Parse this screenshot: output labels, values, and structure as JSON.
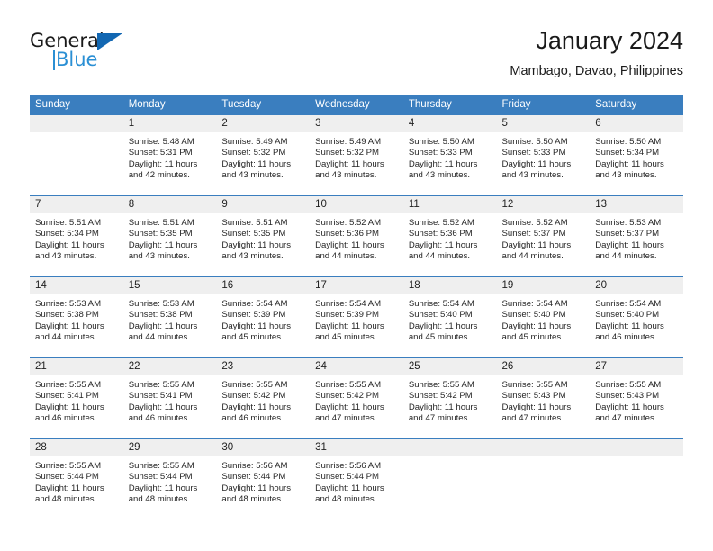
{
  "logo": {
    "text_top": "General",
    "text_bottom": "Blue",
    "accent_dark": "#1267b2",
    "accent_light": "#2a8fd4"
  },
  "header": {
    "title": "January 2024",
    "subtitle": "Mambago, Davao, Philippines"
  },
  "theme": {
    "header_blue": "#3a7ebf",
    "daynum_gray": "#efefef",
    "text": "#222222"
  },
  "weekdays": [
    "Sunday",
    "Monday",
    "Tuesday",
    "Wednesday",
    "Thursday",
    "Friday",
    "Saturday"
  ],
  "weeks": [
    [
      {
        "day": "",
        "sunrise": "",
        "sunset": "",
        "daylight1": "",
        "daylight2": ""
      },
      {
        "day": "1",
        "sunrise": "Sunrise: 5:48 AM",
        "sunset": "Sunset: 5:31 PM",
        "daylight1": "Daylight: 11 hours",
        "daylight2": "and 42 minutes."
      },
      {
        "day": "2",
        "sunrise": "Sunrise: 5:49 AM",
        "sunset": "Sunset: 5:32 PM",
        "daylight1": "Daylight: 11 hours",
        "daylight2": "and 43 minutes."
      },
      {
        "day": "3",
        "sunrise": "Sunrise: 5:49 AM",
        "sunset": "Sunset: 5:32 PM",
        "daylight1": "Daylight: 11 hours",
        "daylight2": "and 43 minutes."
      },
      {
        "day": "4",
        "sunrise": "Sunrise: 5:50 AM",
        "sunset": "Sunset: 5:33 PM",
        "daylight1": "Daylight: 11 hours",
        "daylight2": "and 43 minutes."
      },
      {
        "day": "5",
        "sunrise": "Sunrise: 5:50 AM",
        "sunset": "Sunset: 5:33 PM",
        "daylight1": "Daylight: 11 hours",
        "daylight2": "and 43 minutes."
      },
      {
        "day": "6",
        "sunrise": "Sunrise: 5:50 AM",
        "sunset": "Sunset: 5:34 PM",
        "daylight1": "Daylight: 11 hours",
        "daylight2": "and 43 minutes."
      }
    ],
    [
      {
        "day": "7",
        "sunrise": "Sunrise: 5:51 AM",
        "sunset": "Sunset: 5:34 PM",
        "daylight1": "Daylight: 11 hours",
        "daylight2": "and 43 minutes."
      },
      {
        "day": "8",
        "sunrise": "Sunrise: 5:51 AM",
        "sunset": "Sunset: 5:35 PM",
        "daylight1": "Daylight: 11 hours",
        "daylight2": "and 43 minutes."
      },
      {
        "day": "9",
        "sunrise": "Sunrise: 5:51 AM",
        "sunset": "Sunset: 5:35 PM",
        "daylight1": "Daylight: 11 hours",
        "daylight2": "and 43 minutes."
      },
      {
        "day": "10",
        "sunrise": "Sunrise: 5:52 AM",
        "sunset": "Sunset: 5:36 PM",
        "daylight1": "Daylight: 11 hours",
        "daylight2": "and 44 minutes."
      },
      {
        "day": "11",
        "sunrise": "Sunrise: 5:52 AM",
        "sunset": "Sunset: 5:36 PM",
        "daylight1": "Daylight: 11 hours",
        "daylight2": "and 44 minutes."
      },
      {
        "day": "12",
        "sunrise": "Sunrise: 5:52 AM",
        "sunset": "Sunset: 5:37 PM",
        "daylight1": "Daylight: 11 hours",
        "daylight2": "and 44 minutes."
      },
      {
        "day": "13",
        "sunrise": "Sunrise: 5:53 AM",
        "sunset": "Sunset: 5:37 PM",
        "daylight1": "Daylight: 11 hours",
        "daylight2": "and 44 minutes."
      }
    ],
    [
      {
        "day": "14",
        "sunrise": "Sunrise: 5:53 AM",
        "sunset": "Sunset: 5:38 PM",
        "daylight1": "Daylight: 11 hours",
        "daylight2": "and 44 minutes."
      },
      {
        "day": "15",
        "sunrise": "Sunrise: 5:53 AM",
        "sunset": "Sunset: 5:38 PM",
        "daylight1": "Daylight: 11 hours",
        "daylight2": "and 44 minutes."
      },
      {
        "day": "16",
        "sunrise": "Sunrise: 5:54 AM",
        "sunset": "Sunset: 5:39 PM",
        "daylight1": "Daylight: 11 hours",
        "daylight2": "and 45 minutes."
      },
      {
        "day": "17",
        "sunrise": "Sunrise: 5:54 AM",
        "sunset": "Sunset: 5:39 PM",
        "daylight1": "Daylight: 11 hours",
        "daylight2": "and 45 minutes."
      },
      {
        "day": "18",
        "sunrise": "Sunrise: 5:54 AM",
        "sunset": "Sunset: 5:40 PM",
        "daylight1": "Daylight: 11 hours",
        "daylight2": "and 45 minutes."
      },
      {
        "day": "19",
        "sunrise": "Sunrise: 5:54 AM",
        "sunset": "Sunset: 5:40 PM",
        "daylight1": "Daylight: 11 hours",
        "daylight2": "and 45 minutes."
      },
      {
        "day": "20",
        "sunrise": "Sunrise: 5:54 AM",
        "sunset": "Sunset: 5:40 PM",
        "daylight1": "Daylight: 11 hours",
        "daylight2": "and 46 minutes."
      }
    ],
    [
      {
        "day": "21",
        "sunrise": "Sunrise: 5:55 AM",
        "sunset": "Sunset: 5:41 PM",
        "daylight1": "Daylight: 11 hours",
        "daylight2": "and 46 minutes."
      },
      {
        "day": "22",
        "sunrise": "Sunrise: 5:55 AM",
        "sunset": "Sunset: 5:41 PM",
        "daylight1": "Daylight: 11 hours",
        "daylight2": "and 46 minutes."
      },
      {
        "day": "23",
        "sunrise": "Sunrise: 5:55 AM",
        "sunset": "Sunset: 5:42 PM",
        "daylight1": "Daylight: 11 hours",
        "daylight2": "and 46 minutes."
      },
      {
        "day": "24",
        "sunrise": "Sunrise: 5:55 AM",
        "sunset": "Sunset: 5:42 PM",
        "daylight1": "Daylight: 11 hours",
        "daylight2": "and 47 minutes."
      },
      {
        "day": "25",
        "sunrise": "Sunrise: 5:55 AM",
        "sunset": "Sunset: 5:42 PM",
        "daylight1": "Daylight: 11 hours",
        "daylight2": "and 47 minutes."
      },
      {
        "day": "26",
        "sunrise": "Sunrise: 5:55 AM",
        "sunset": "Sunset: 5:43 PM",
        "daylight1": "Daylight: 11 hours",
        "daylight2": "and 47 minutes."
      },
      {
        "day": "27",
        "sunrise": "Sunrise: 5:55 AM",
        "sunset": "Sunset: 5:43 PM",
        "daylight1": "Daylight: 11 hours",
        "daylight2": "and 47 minutes."
      }
    ],
    [
      {
        "day": "28",
        "sunrise": "Sunrise: 5:55 AM",
        "sunset": "Sunset: 5:44 PM",
        "daylight1": "Daylight: 11 hours",
        "daylight2": "and 48 minutes."
      },
      {
        "day": "29",
        "sunrise": "Sunrise: 5:55 AM",
        "sunset": "Sunset: 5:44 PM",
        "daylight1": "Daylight: 11 hours",
        "daylight2": "and 48 minutes."
      },
      {
        "day": "30",
        "sunrise": "Sunrise: 5:56 AM",
        "sunset": "Sunset: 5:44 PM",
        "daylight1": "Daylight: 11 hours",
        "daylight2": "and 48 minutes."
      },
      {
        "day": "31",
        "sunrise": "Sunrise: 5:56 AM",
        "sunset": "Sunset: 5:44 PM",
        "daylight1": "Daylight: 11 hours",
        "daylight2": "and 48 minutes."
      },
      {
        "day": "",
        "sunrise": "",
        "sunset": "",
        "daylight1": "",
        "daylight2": ""
      },
      {
        "day": "",
        "sunrise": "",
        "sunset": "",
        "daylight1": "",
        "daylight2": ""
      },
      {
        "day": "",
        "sunrise": "",
        "sunset": "",
        "daylight1": "",
        "daylight2": ""
      }
    ]
  ]
}
